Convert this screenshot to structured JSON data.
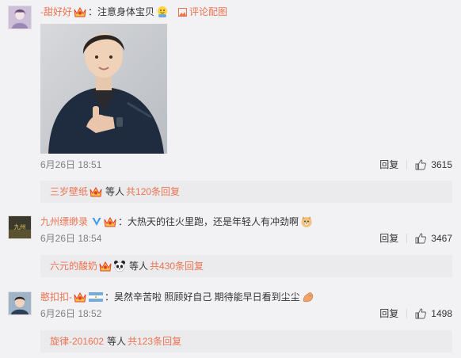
{
  "comments": [
    {
      "username": "-甜好好",
      "text": "注意身体宝贝",
      "pic_link": "评论配图",
      "date": "6月26日 18:51",
      "reply_label": "回复",
      "likes": "3615",
      "sub_user": "三岁壁纸",
      "sub_text": "等人",
      "sub_more": "共120条回复"
    },
    {
      "username": "九州缥缈录",
      "text": "大热天的往火里跑，还是年轻人有冲劲啊",
      "date": "6月26日 18:54",
      "reply_label": "回复",
      "likes": "3467",
      "sub_user": "六元的酸奶",
      "sub_text": "等人",
      "sub_more": "共430条回复"
    },
    {
      "username": "憨扣扣-",
      "text": "昊然辛苦啦 照顾好自己 期待能早日看到尘尘",
      "date": "6月26日 18:52",
      "reply_label": "回复",
      "likes": "1498",
      "sub_user": "旋律-201602",
      "sub_text": "等人",
      "sub_more": "共123条回复"
    }
  ],
  "colors": {
    "accent": "#eb7350",
    "background": "#f2f2f5",
    "subbox": "#ebebee"
  }
}
